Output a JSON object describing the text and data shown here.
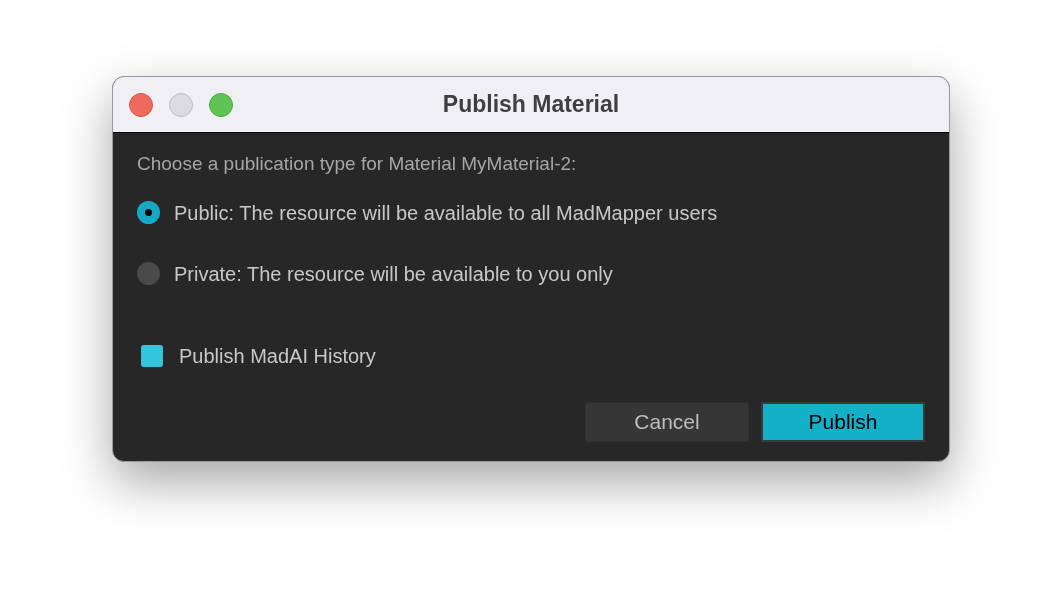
{
  "window": {
    "title": "Publish Material"
  },
  "prompt": "Choose a publication type for Material MyMaterial-2:",
  "options": [
    {
      "label": "Public: The resource will be available to all MadMapper users",
      "selected": true
    },
    {
      "label": "Private: The resource will be available to you only",
      "selected": false
    }
  ],
  "checkbox": {
    "label": "Publish MadAI History",
    "checked": true
  },
  "buttons": [
    {
      "label": "Cancel",
      "kind": "secondary"
    },
    {
      "label": "Publish",
      "kind": "primary"
    }
  ]
}
